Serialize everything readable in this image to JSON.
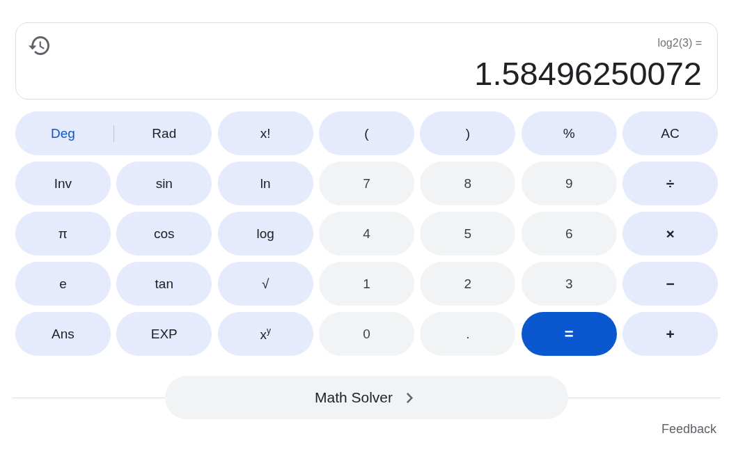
{
  "display": {
    "expression": "log2(3) =",
    "result": "1.58496250072"
  },
  "keypad": {
    "rows": [
      [
        {
          "kind": "angle",
          "label": "Deg",
          "selected": true
        },
        {
          "kind": "angle",
          "label": "Rad",
          "selected": false
        },
        {
          "kind": "function",
          "label": "x!"
        },
        {
          "kind": "function",
          "label": "("
        },
        {
          "kind": "function",
          "label": ")"
        },
        {
          "kind": "function",
          "label": "%"
        },
        {
          "kind": "function",
          "label": "AC"
        }
      ],
      [
        {
          "kind": "function",
          "label": "Inv"
        },
        {
          "kind": "function",
          "label": "sin"
        },
        {
          "kind": "function",
          "label": "ln"
        },
        {
          "kind": "digit",
          "label": "7"
        },
        {
          "kind": "digit",
          "label": "8"
        },
        {
          "kind": "digit",
          "label": "9"
        },
        {
          "kind": "operator",
          "label": "÷"
        }
      ],
      [
        {
          "kind": "function",
          "label": "π"
        },
        {
          "kind": "function",
          "label": "cos"
        },
        {
          "kind": "function",
          "label": "log"
        },
        {
          "kind": "digit",
          "label": "4"
        },
        {
          "kind": "digit",
          "label": "5"
        },
        {
          "kind": "digit",
          "label": "6"
        },
        {
          "kind": "operator",
          "label": "×"
        }
      ],
      [
        {
          "kind": "function",
          "label": "e"
        },
        {
          "kind": "function",
          "label": "tan"
        },
        {
          "kind": "function",
          "label": "√"
        },
        {
          "kind": "digit",
          "label": "1"
        },
        {
          "kind": "digit",
          "label": "2"
        },
        {
          "kind": "digit",
          "label": "3"
        },
        {
          "kind": "operator",
          "label": "−"
        }
      ],
      [
        {
          "kind": "function",
          "label": "Ans"
        },
        {
          "kind": "function",
          "label": "EXP"
        },
        {
          "kind": "function",
          "label": "x$^{y}$"
        },
        {
          "kind": "digit",
          "label": "0"
        },
        {
          "kind": "digit",
          "label": "."
        },
        {
          "kind": "equals",
          "label": "="
        },
        {
          "kind": "operator",
          "label": "+"
        }
      ]
    ]
  },
  "math_solver": {
    "label": "Math Solver"
  },
  "feedback": "Feedback"
}
